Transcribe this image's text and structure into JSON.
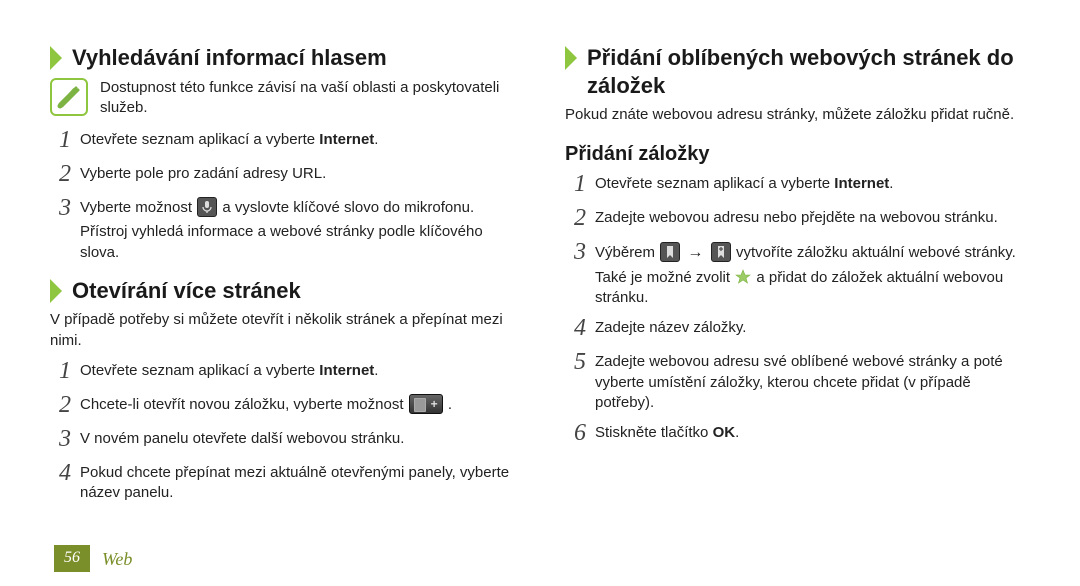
{
  "left": {
    "s1": {
      "title": "Vyhledávání informací hlasem",
      "note": "Dostupnost této funkce závisí na vaší oblasti a poskytovateli služeb.",
      "steps": [
        {
          "n": "1",
          "pre": "Otevřete seznam aplikací a vyberte ",
          "bold": "Internet",
          "post": "."
        },
        {
          "n": "2",
          "text": "Vyberte pole pro zadání adresy URL."
        },
        {
          "n": "3",
          "pre": "Vyberte možnost ",
          "icon": "mic",
          "post": " a vyslovte klíčové slovo do mikrofonu.",
          "extra": "Přístroj vyhledá informace a webové stránky podle klíčového slova."
        }
      ]
    },
    "s2": {
      "title": "Otevírání více stránek",
      "intro": "V případě potřeby si můžete otevřít i několik stránek a přepínat mezi nimi.",
      "steps": [
        {
          "n": "1",
          "pre": "Otevřete seznam aplikací a vyberte ",
          "bold": "Internet",
          "post": "."
        },
        {
          "n": "2",
          "pre": "Chcete-li otevřít novou záložku, vyberte možnost ",
          "icon": "tab_plus",
          "post": " ."
        },
        {
          "n": "3",
          "text": "V novém panelu otevřete další webovou stránku."
        },
        {
          "n": "4",
          "text": "Pokud chcete přepínat mezi aktuálně otevřenými panely, vyberte název panelu."
        }
      ]
    }
  },
  "right": {
    "s1": {
      "title": "Přidání oblíbených webových stránek do záložek",
      "intro": "Pokud znáte webovou adresu stránky, můžete záložku přidat ručně.",
      "sub": "Přidání záložky",
      "steps": [
        {
          "n": "1",
          "pre": "Otevřete seznam aplikací a vyberte ",
          "bold": "Internet",
          "post": "."
        },
        {
          "n": "2",
          "text": "Zadejte webovou adresu nebo přejděte na webovou stránku."
        },
        {
          "n": "3",
          "l1_pre": "Výběrem ",
          "l1_mid": " → ",
          "l1_post": " vytvoříte záložku aktuální webové stránky.",
          "extra_pre": "Také je možné zvolit ",
          "extra_post": " a přidat do záložek aktuální webovou stránku."
        },
        {
          "n": "4",
          "text": "Zadejte název záložky."
        },
        {
          "n": "5",
          "text": "Zadejte webovou adresu své oblíbené webové stránky a poté vyberte umístění záložky, kterou chcete přidat (v případě potřeby)."
        },
        {
          "n": "6",
          "pre": "Stiskněte tlačítko ",
          "bold": "OK",
          "post": "."
        }
      ]
    }
  },
  "footer": {
    "page": "56",
    "section": "Web"
  }
}
